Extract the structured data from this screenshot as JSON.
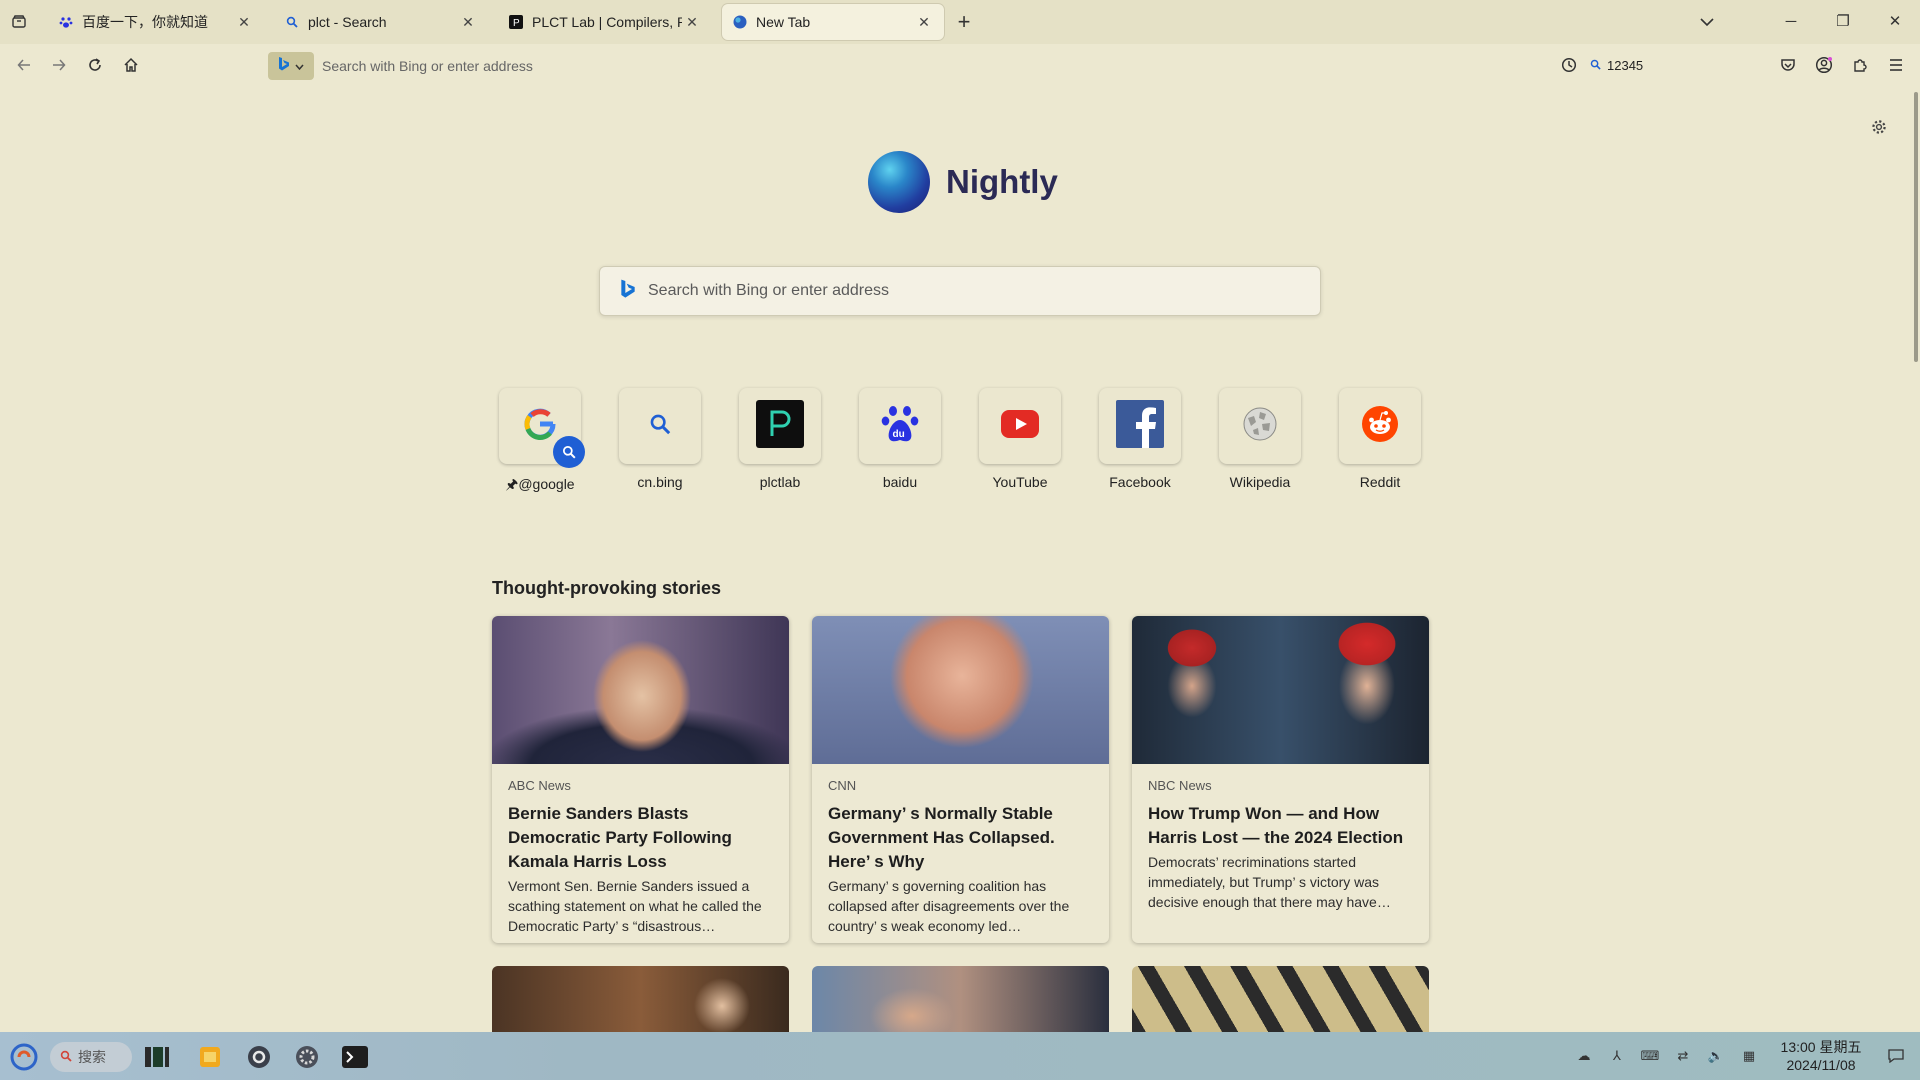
{
  "tabs": [
    {
      "title": "百度一下，你就知道",
      "icon": "baidu-paw-icon",
      "active": false
    },
    {
      "title": "plct - Search",
      "icon": "search-icon",
      "active": false
    },
    {
      "title": "PLCT Lab | Compilers, Runt",
      "icon": "plct-p-icon",
      "active": false
    },
    {
      "title": "New Tab",
      "icon": "nightly-globe-icon",
      "active": true
    }
  ],
  "toolbar": {
    "url_placeholder": "Search with Bing or enter address",
    "side_search_value": "12345"
  },
  "newtab": {
    "brand": "Nightly",
    "search_placeholder": "Search with Bing or enter address",
    "shortcuts": [
      {
        "label": "@google",
        "icon": "google-icon",
        "pinned": true
      },
      {
        "label": "cn.bing",
        "icon": "search-icon"
      },
      {
        "label": "plctlab",
        "icon": "plct-p-icon"
      },
      {
        "label": "baidu",
        "icon": "baidu-paw-icon"
      },
      {
        "label": "YouTube",
        "icon": "youtube-icon"
      },
      {
        "label": "Facebook",
        "icon": "facebook-icon"
      },
      {
        "label": "Wikipedia",
        "icon": "wikipedia-globe-icon"
      },
      {
        "label": "Reddit",
        "icon": "reddit-icon"
      }
    ],
    "stories_heading": "Thought-provoking stories",
    "stories": [
      {
        "source": "ABC News",
        "headline": "Bernie Sanders Blasts Democratic Party Following Kamala Harris Loss",
        "excerpt": "Vermont Sen. Bernie Sanders issued a scathing statement on what he called the Democratic Party’ s “disastrous…"
      },
      {
        "source": "CNN",
        "headline": "Germany’ s Normally Stable Government Has Collapsed. Here’ s Why",
        "excerpt": "Germany’ s governing coalition has collapsed after disagreements over the country’ s weak economy led…"
      },
      {
        "source": "NBC News",
        "headline": "How Trump Won — and How Harris Lost — the 2024 Election",
        "excerpt": "Democrats’  recriminations started immediately, but Trump’ s victory was decisive enough that there may have…"
      }
    ]
  },
  "taskbar": {
    "search_placeholder": "搜索",
    "clock_time": "13:00 星期五",
    "clock_date": "2024/11/08"
  }
}
